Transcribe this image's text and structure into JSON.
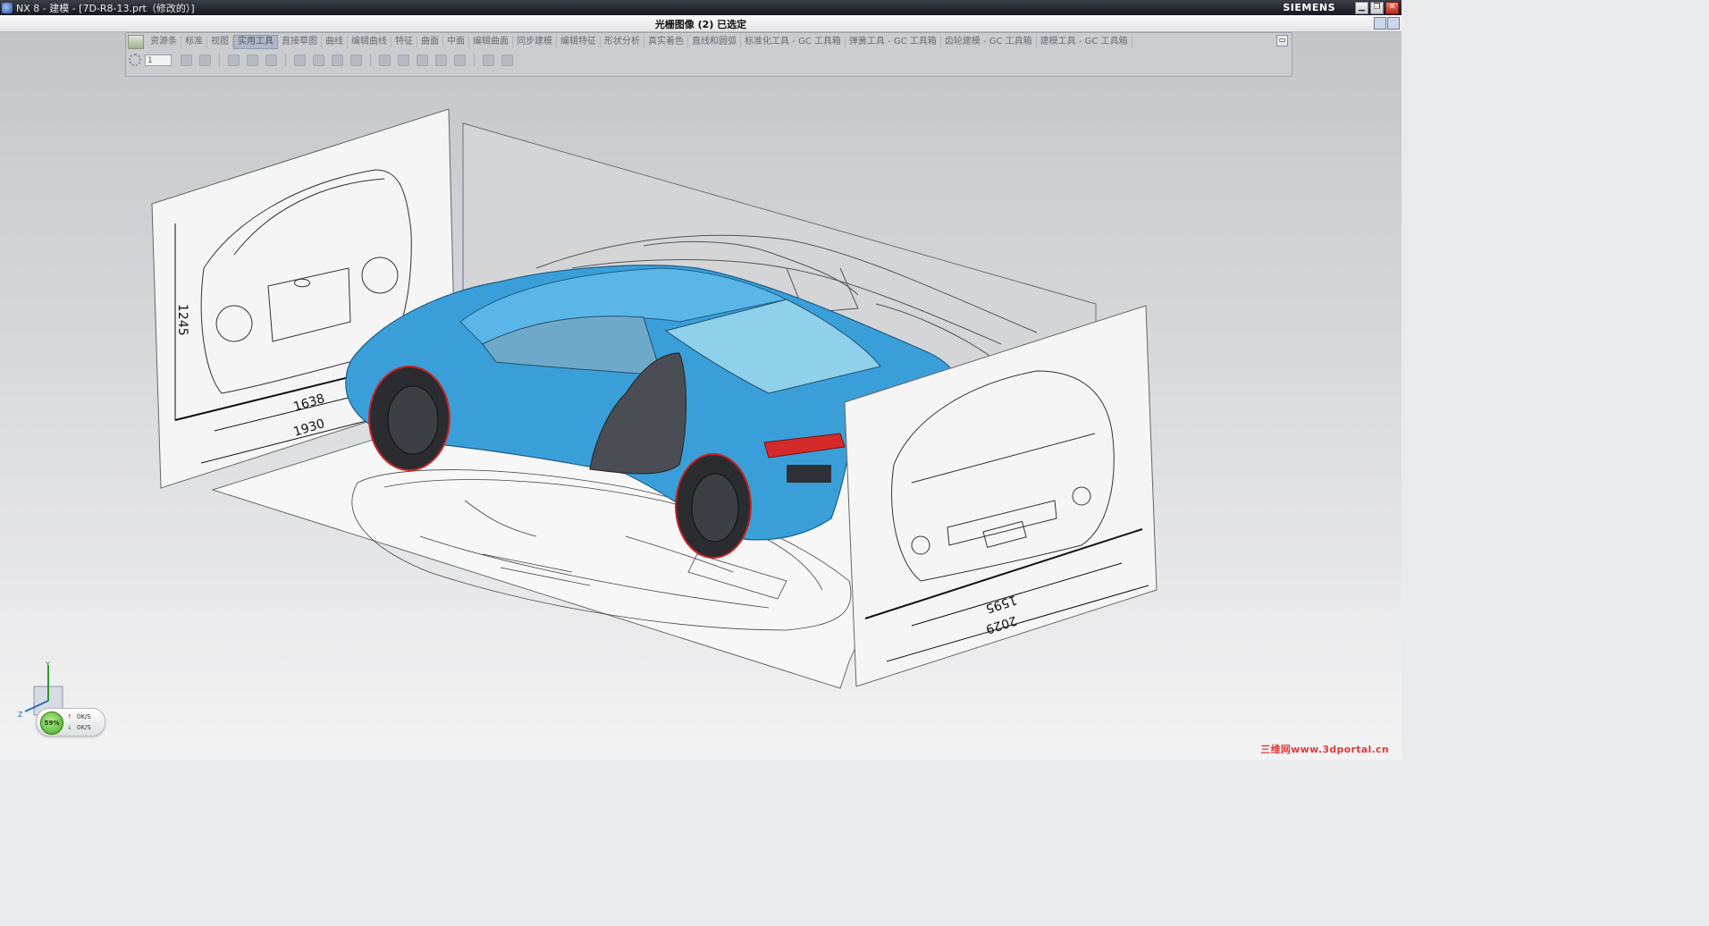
{
  "window": {
    "title": "NX 8 - 建模 - [7D-R8-13.prt（修改的）]",
    "brand": "SIEMENS",
    "controls": {
      "minimize": "▁",
      "restore": "❐",
      "close": "✕"
    }
  },
  "status": {
    "message": "光栅图像 (2) 已选定"
  },
  "ribbon": {
    "tabs": [
      "资源条",
      "标准",
      "视图",
      "实用工具",
      "直接草图",
      "曲线",
      "编辑曲线",
      "特征",
      "曲面",
      "中面",
      "编辑曲面",
      "同步建模",
      "编辑特征",
      "形状分析",
      "真实着色",
      "直线和圆弧",
      "标准化工具 - GC 工具箱",
      "弹簧工具 - GC 工具箱",
      "齿轮建模 - GC 工具箱",
      "建模工具 - GC 工具箱"
    ],
    "active_tab": "实用工具",
    "layer_select": "1"
  },
  "drawings": {
    "front_height": "1245",
    "front_width_inner": "1638",
    "front_width_outer": "1930",
    "rear_width_inner": "1595",
    "rear_width_outer": "2029"
  },
  "triad": {
    "z_label": "Z",
    "y_label": "Y"
  },
  "performance": {
    "load": "59%",
    "up_rate": "0K/S",
    "down_rate": "0K/S"
  },
  "watermark": "三维网www.3dportal.cn",
  "colors": {
    "car_body": "#3a9fd8",
    "taillight": "#d52a2a",
    "accent": "#2b6cb8"
  },
  "icons": [
    "app-icon",
    "gear-icon",
    "layer-dropdown-icon",
    "minimize-icon",
    "restore-icon",
    "close-icon",
    "ribbon-collapse-icon"
  ]
}
